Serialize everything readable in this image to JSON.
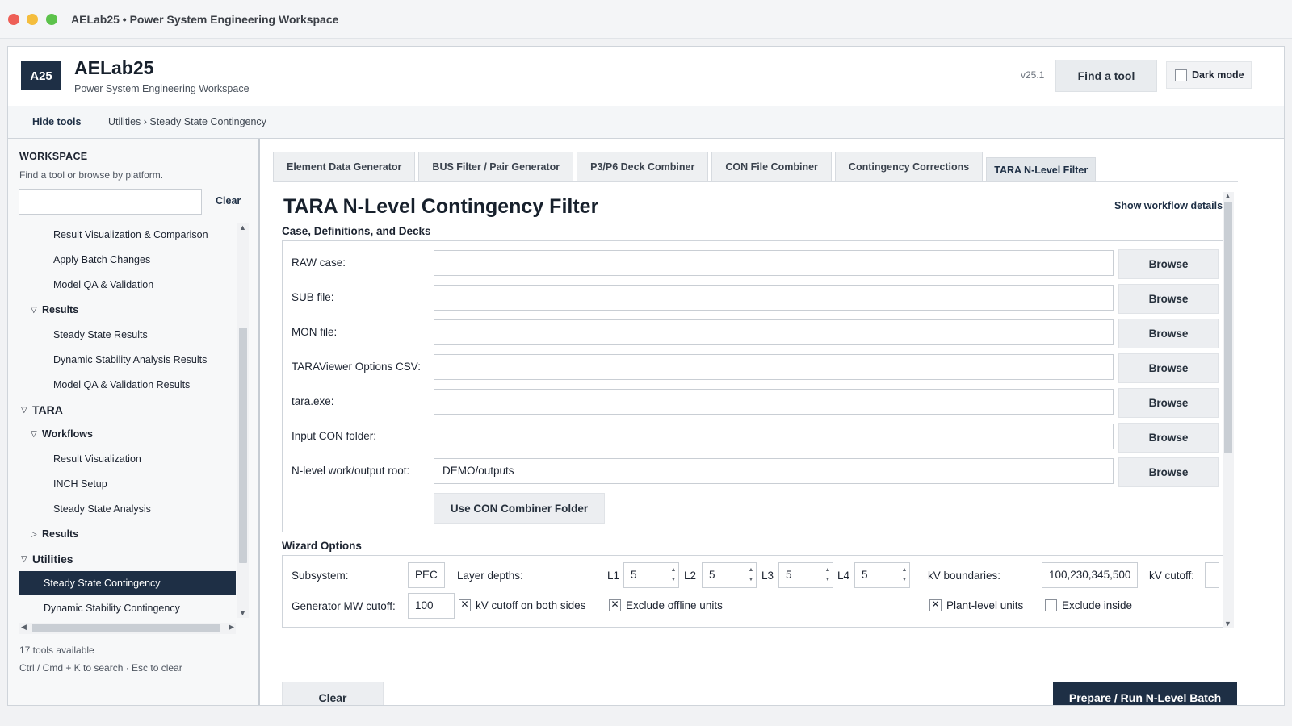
{
  "window": {
    "title": "AELab25 • Power System Engineering Workspace"
  },
  "header": {
    "logo": "A25",
    "app_name": "AELab25",
    "app_subtitle": "Power System Engineering Workspace",
    "version": "v25.1",
    "find_tool": "Find a tool",
    "dark_mode": "Dark mode"
  },
  "subbar": {
    "hide_tools": "Hide tools",
    "breadcrumb": "Utilities › Steady State Contingency"
  },
  "sidebar": {
    "title": "WORKSPACE",
    "subtitle": "Find a tool or browse by platform.",
    "search_value": "",
    "clear": "Clear",
    "items": [
      {
        "label": "Result Visualization & Comparison"
      },
      {
        "label": "Apply Batch Changes"
      },
      {
        "label": "Model QA & Validation"
      },
      {
        "label": "Results"
      },
      {
        "label": "Steady State Results"
      },
      {
        "label": "Dynamic Stability Analysis Results"
      },
      {
        "label": "Model QA & Validation Results"
      },
      {
        "label": "TARA"
      },
      {
        "label": "Workflows"
      },
      {
        "label": "Result Visualization"
      },
      {
        "label": "INCH Setup"
      },
      {
        "label": "Steady State Analysis"
      },
      {
        "label": "Results"
      },
      {
        "label": "Utilities"
      },
      {
        "label": "Steady State Contingency"
      },
      {
        "label": "Dynamic Stability Contingency"
      }
    ],
    "tools_count": "17 tools available",
    "shortcut_hint": "Ctrl / Cmd + K to search · Esc to clear"
  },
  "tabs": [
    {
      "label": "Element Data Generator"
    },
    {
      "label": "BUS Filter / Pair Generator"
    },
    {
      "label": "P3/P6 Deck Combiner"
    },
    {
      "label": "CON File Combiner"
    },
    {
      "label": "Contingency Corrections"
    },
    {
      "label": "TARA N-Level Filter"
    }
  ],
  "page": {
    "title": "TARA N-Level Contingency Filter",
    "workflow_link": "Show workflow details",
    "section1": "Case, Definitions, and Decks",
    "section2": "Wizard Options"
  },
  "file_rows": [
    {
      "label": "RAW case:",
      "value": "",
      "button": "Browse"
    },
    {
      "label": "SUB file:",
      "value": "",
      "button": "Browse"
    },
    {
      "label": "MON file:",
      "value": "",
      "button": "Browse"
    },
    {
      "label": "TARAViewer Options CSV:",
      "value": "",
      "button": "Browse"
    },
    {
      "label": "tara.exe:",
      "value": "",
      "button": "Browse"
    },
    {
      "label": "Input CON folder:",
      "value": "",
      "button": "Browse"
    },
    {
      "label": "N-level work/output root:",
      "value": "DEMO/outputs",
      "button": "Browse"
    }
  ],
  "use_con_button": "Use CON Combiner Folder",
  "wizard": {
    "subsystem_label": "Subsystem:",
    "subsystem_value": "PEC",
    "layer_label": "Layer depths:",
    "l1_label": "L1",
    "l1_value": "5",
    "l2_label": "L2",
    "l2_value": "5",
    "l3_label": "L3",
    "l3_value": "5",
    "l4_label": "L4",
    "l4_value": "5",
    "kv_boundaries_label": "kV boundaries:",
    "kv_boundaries_value": "100,230,345,500",
    "kv_cutoff_label": "kV cutoff:",
    "kv_cutoff_value": "",
    "gen_mw_label": "Generator MW cutoff:",
    "gen_mw_value": "100",
    "cb_kv_both": "kV cutoff on both sides",
    "cb_exclude_offline": "Exclude offline units",
    "cb_plant_level": "Plant-level units",
    "cb_exclude_inside": "Exclude inside"
  },
  "actions": {
    "clear": "Clear",
    "run": "Prepare / Run N-Level Batch"
  }
}
